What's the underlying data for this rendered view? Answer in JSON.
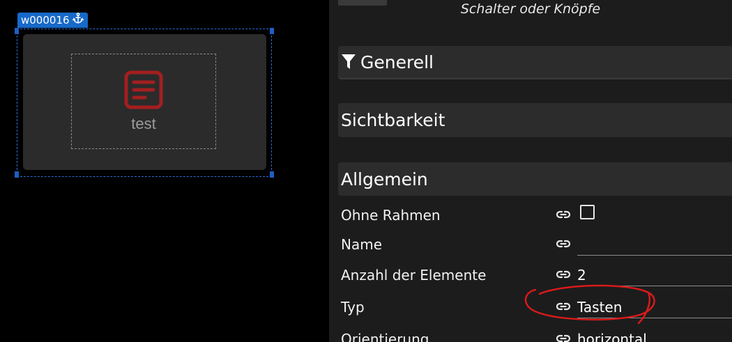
{
  "canvas": {
    "widget_id": "w000016",
    "widget_label": "test",
    "anchor_icon": "anchor-icon",
    "widget_icon": "document-icon",
    "widget_icon_color": "#a31f1f",
    "selection_color": "#1769c9"
  },
  "panel": {
    "subtitle": "Schalter oder Knöpfe",
    "sections": {
      "general": "Generell",
      "visibility": "Sichtbarkeit",
      "common": "Allgemein"
    },
    "fields": {
      "no_border": {
        "label": "Ohne Rahmen",
        "checked": false
      },
      "name": {
        "label": "Name",
        "value": ""
      },
      "count": {
        "label": "Anzahl der Elemente",
        "value": "2"
      },
      "type": {
        "label": "Typ",
        "value": "Tasten"
      },
      "orientation": {
        "label": "Orientierung",
        "value": "horizontal"
      }
    },
    "icons": {
      "filter": "filter-icon",
      "link": "link-icon"
    },
    "annotation_color": "#d91a1a"
  }
}
